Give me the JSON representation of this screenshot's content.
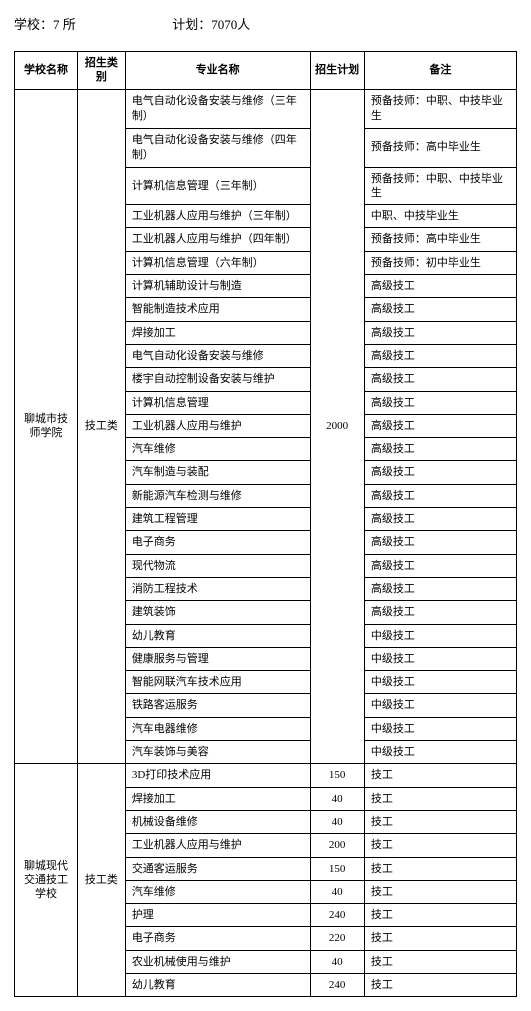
{
  "header": {
    "school_count_label": "学校：7 所",
    "plan_count_label": "计划：7070人"
  },
  "columns": {
    "school": "学校名称",
    "category": "招生类别",
    "major": "专业名称",
    "plan": "招生计划",
    "remark": "备注"
  },
  "block1": {
    "school": "聊城市技师学院",
    "category": "技工类",
    "plan": "2000",
    "rows": [
      {
        "major": "电气自动化设备安装与维修（三年制）",
        "remark": "预备技师：中职、中技毕业生",
        "tall": true
      },
      {
        "major": "电气自动化设备安装与维修（四年制）",
        "remark": "预备技师：高中毕业生",
        "tall": true
      },
      {
        "major": "计算机信息管理（三年制）",
        "remark": "预备技师：中职、中技毕业生"
      },
      {
        "major": "工业机器人应用与维护（三年制）",
        "remark": "中职、中技毕业生"
      },
      {
        "major": "工业机器人应用与维护（四年制）",
        "remark": "预备技师：高中毕业生"
      },
      {
        "major": "计算机信息管理（六年制）",
        "remark": "预备技师：初中毕业生"
      },
      {
        "major": "计算机辅助设计与制造",
        "remark": "高级技工"
      },
      {
        "major": "智能制造技术应用",
        "remark": "高级技工"
      },
      {
        "major": "焊接加工",
        "remark": "高级技工"
      },
      {
        "major": "电气自动化设备安装与维修",
        "remark": "高级技工"
      },
      {
        "major": "楼宇自动控制设备安装与维护",
        "remark": "高级技工"
      },
      {
        "major": "计算机信息管理",
        "remark": "高级技工"
      },
      {
        "major": "工业机器人应用与维护",
        "remark": "高级技工"
      },
      {
        "major": "汽车维修",
        "remark": "高级技工"
      },
      {
        "major": "汽车制造与装配",
        "remark": "高级技工"
      },
      {
        "major": "新能源汽车检测与维修",
        "remark": "高级技工"
      },
      {
        "major": "建筑工程管理",
        "remark": "高级技工"
      },
      {
        "major": "电子商务",
        "remark": "高级技工"
      },
      {
        "major": "现代物流",
        "remark": "高级技工"
      },
      {
        "major": "消防工程技术",
        "remark": "高级技工"
      },
      {
        "major": "建筑装饰",
        "remark": "高级技工"
      },
      {
        "major": "幼儿教育",
        "remark": "中级技工"
      },
      {
        "major": "健康服务与管理",
        "remark": "中级技工"
      },
      {
        "major": "智能网联汽车技术应用",
        "remark": "中级技工"
      },
      {
        "major": "铁路客运服务",
        "remark": "中级技工"
      },
      {
        "major": "汽车电器维修",
        "remark": "中级技工"
      },
      {
        "major": "汽车装饰与美容",
        "remark": "中级技工"
      }
    ]
  },
  "block2": {
    "school": "聊城现代交通技工学校",
    "category": "技工类",
    "rows": [
      {
        "major": "3D打印技术应用",
        "plan": "150",
        "remark": "技工"
      },
      {
        "major": "焊接加工",
        "plan": "40",
        "remark": "技工"
      },
      {
        "major": "机械设备维修",
        "plan": "40",
        "remark": "技工"
      },
      {
        "major": "工业机器人应用与维护",
        "plan": "200",
        "remark": "技工"
      },
      {
        "major": "交通客运服务",
        "plan": "150",
        "remark": "技工"
      },
      {
        "major": "汽车维修",
        "plan": "40",
        "remark": "技工"
      },
      {
        "major": "护理",
        "plan": "240",
        "remark": "技工"
      },
      {
        "major": "电子商务",
        "plan": "220",
        "remark": "技工"
      },
      {
        "major": "农业机械使用与维护",
        "plan": "40",
        "remark": "技工"
      },
      {
        "major": "幼儿教育",
        "plan": "240",
        "remark": "技工"
      }
    ]
  }
}
